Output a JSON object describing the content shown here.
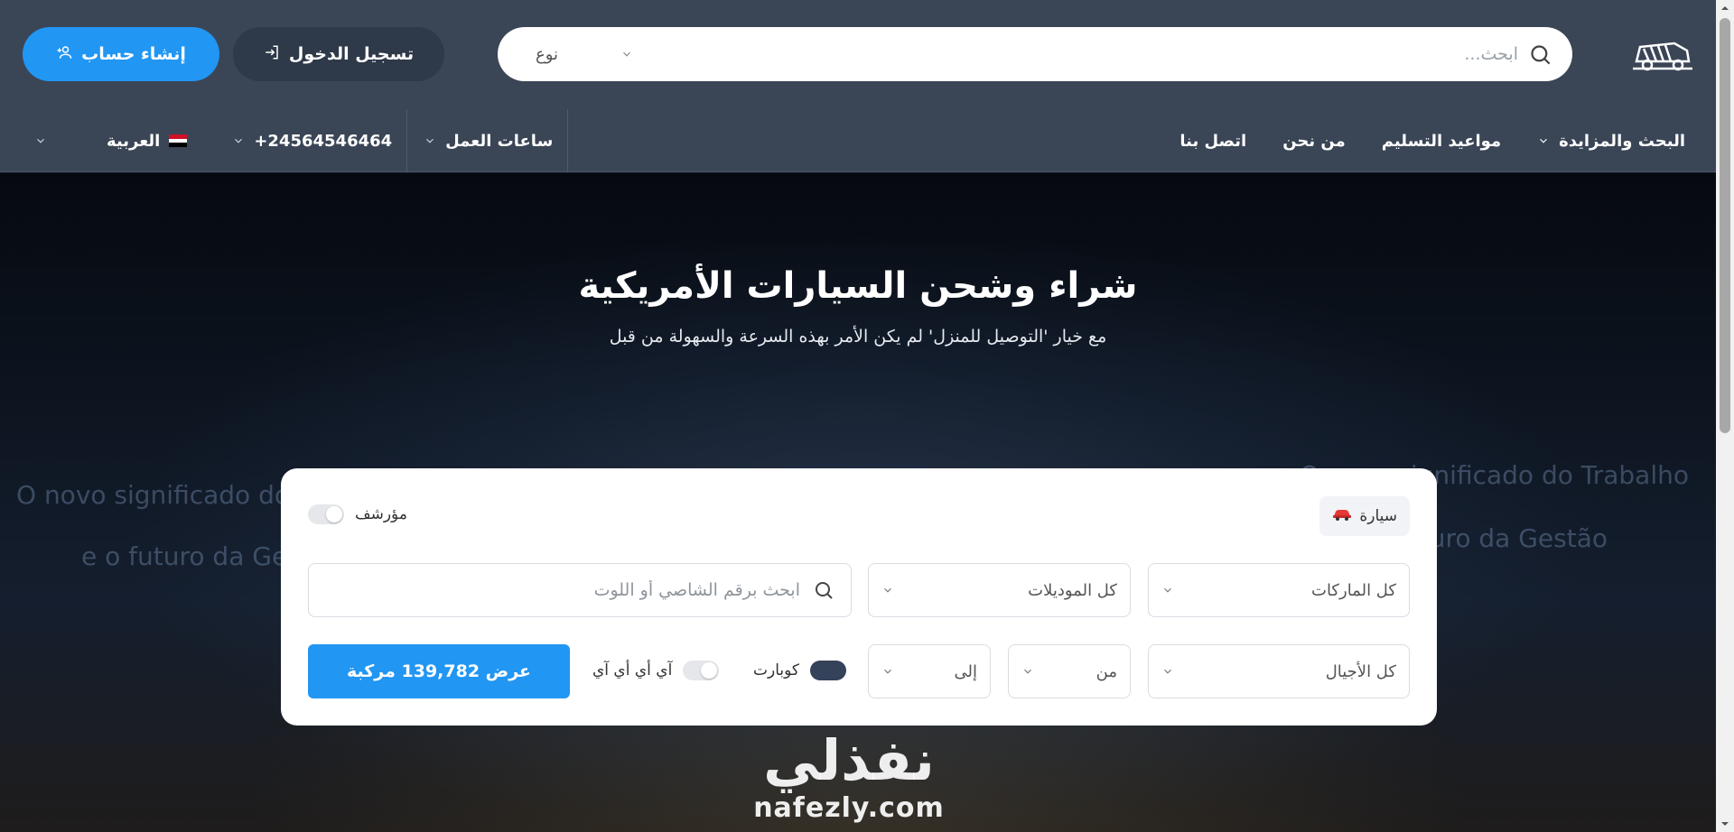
{
  "header": {
    "search": {
      "placeholder": "ابحث..."
    },
    "type_select": {
      "label": "نوع"
    },
    "login_label": "تسجيل الدخول",
    "register_label": "إنشاء حساب"
  },
  "nav": {
    "items": [
      {
        "label": "البحث والمزايدة",
        "has_dropdown": true
      },
      {
        "label": "مواعيد التسليم"
      },
      {
        "label": "من نحن"
      },
      {
        "label": "اتصل بنا"
      }
    ],
    "hours_label": "ساعات العمل",
    "phone": "+24564546464",
    "language": "العربية"
  },
  "hero": {
    "title": "شراء وشحن السيارات الأمريكية",
    "subtitle": "مع خيار 'التوصيل للمنزل' لم يكن الأمر بهذه السرعة والسهولة من قبل",
    "background_text": [
      "O novo significado do Trabalho",
      "e o futuro da Gestão",
      "O novo significado do Trab",
      "e o futuro da Gestão"
    ]
  },
  "search_card": {
    "tab_car": "سيارة",
    "archived_label": "مؤرشف",
    "makes_placeholder": "كل الماركات",
    "models_placeholder": "كل الموديلات",
    "vin_placeholder": "ابحث برقم الشاصي أو اللوت",
    "years_placeholder": "كل الأجيال",
    "from_label": "من",
    "to_label": "إلى",
    "copart_label": "كوبارت",
    "copart_on": true,
    "iaai_label": "آي أي أي آي",
    "iaai_on": false,
    "show_button": "عرض 139,782 مركبة"
  },
  "watermark": {
    "arabic": "نفذلي",
    "latin": "nafezly.com"
  },
  "colors": {
    "primary": "#2196f3",
    "header_bg": "#3a4556",
    "login_bg": "#2e3949"
  }
}
